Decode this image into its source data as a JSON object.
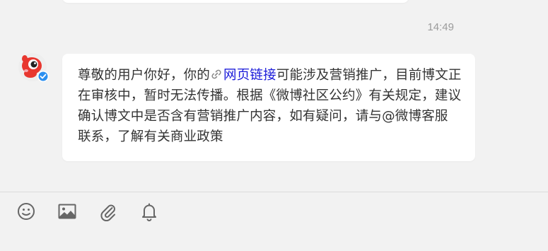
{
  "conversation": {
    "timestamp": "14:49",
    "message": {
      "sender_avatar": "weibo-assistant-avatar",
      "text_before_link": "尊敬的用户你好，你的",
      "link_icon": "link-icon",
      "link_text": "网页链接",
      "text_after_link": "可能涉及营销推广，目前博文正在审核中，暂时无法传播。根据《微博社区公约》有关规定，建议确认博文中是否含有营销推广内容，如有疑问，请与@微博客服 联系，了解有关商业政策"
    }
  },
  "toolbar": {
    "items": [
      {
        "icon": "emoji-icon"
      },
      {
        "icon": "image-icon"
      },
      {
        "icon": "attachment-icon"
      },
      {
        "icon": "bell-icon"
      }
    ]
  },
  "colors": {
    "background": "#f2f2f2",
    "bubble": "#ffffff",
    "text": "#333333",
    "link": "#1a1ad9",
    "timestamp": "#9b9b9b",
    "icon": "#666666",
    "verified_badge": "#2b8ff0"
  }
}
